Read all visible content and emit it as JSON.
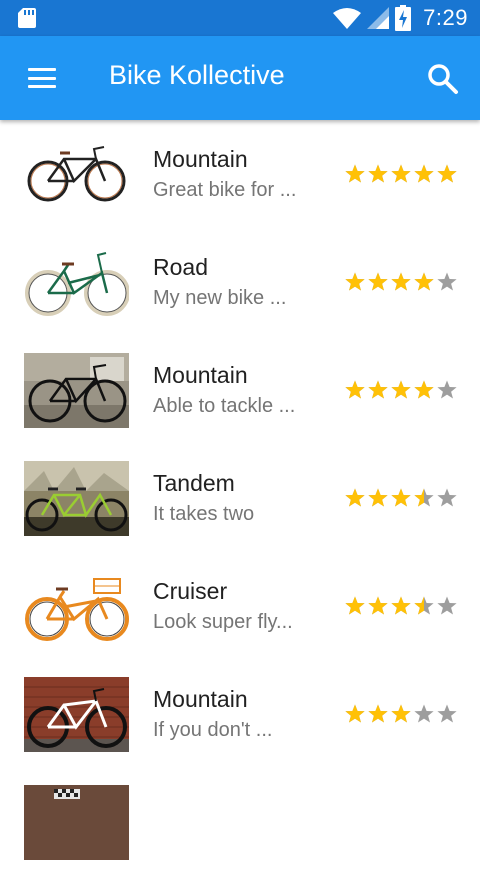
{
  "status_bar": {
    "time": "7:29"
  },
  "app_bar": {
    "title": "Bike Kollective"
  },
  "colors": {
    "status_bar": "#1976d2",
    "app_bar": "#2196f3",
    "star_filled": "#ffc107",
    "star_empty": "#9e9e9e"
  },
  "bikes": [
    {
      "type": "Mountain",
      "description": "Great bike for ...",
      "rating": 5,
      "image": "black-city-bike-white-background"
    },
    {
      "type": "Road",
      "description": "My new bike ...",
      "rating": 4,
      "image": "green-cream-city-bike-white-background"
    },
    {
      "type": "Mountain",
      "description": "Able to tackle ...",
      "rating": 4,
      "image": "black-bike-street-photo"
    },
    {
      "type": "Tandem",
      "description": "It takes two",
      "rating": 3.5,
      "image": "green-tandem-bike-field-photo"
    },
    {
      "type": "Cruiser",
      "description": "Look super fly...",
      "rating": 3.5,
      "image": "orange-cruiser-with-basket"
    },
    {
      "type": "Mountain",
      "description": "If you don't ...",
      "rating": 3,
      "image": "white-mountain-bike-brick-wall"
    },
    {
      "type": "",
      "description": "",
      "rating": 0,
      "image": "partial-bike-photo"
    }
  ]
}
